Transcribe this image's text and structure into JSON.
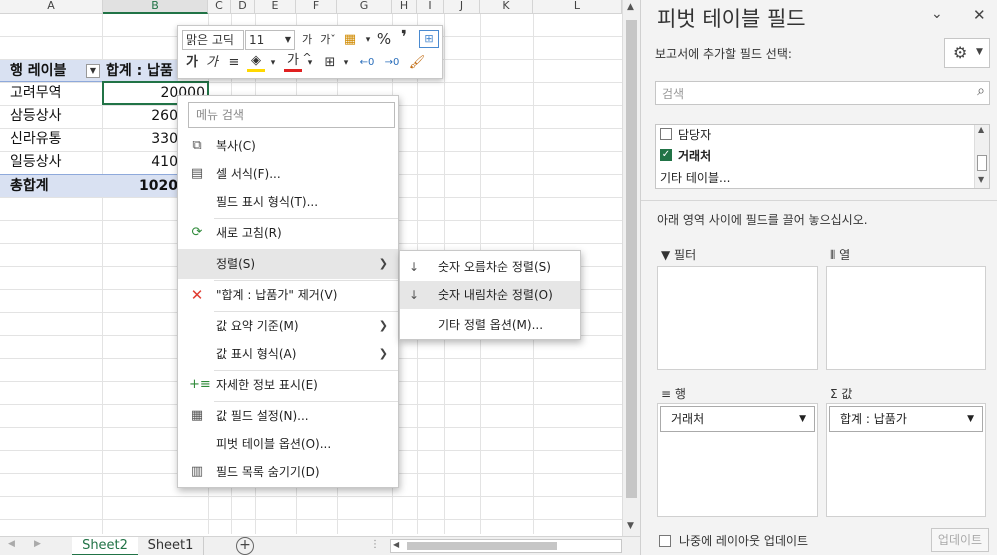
{
  "columns": [
    "A",
    "B",
    "C",
    "D",
    "E",
    "F",
    "G",
    "H",
    "I",
    "J",
    "K",
    "L"
  ],
  "pivot": {
    "row_label_header": "행 레이블",
    "value_header": "합계 : 납품",
    "rows": [
      {
        "label": "고려무역",
        "value": "20000"
      },
      {
        "label": "삼등상사",
        "value": "260"
      },
      {
        "label": "신라유통",
        "value": "330"
      },
      {
        "label": "일등상사",
        "value": "410"
      }
    ],
    "total_label": "총합계",
    "total_value": "1020"
  },
  "mini_toolbar": {
    "font_name": "맑은 고딕",
    "font_size": "11",
    "grow_font": "가^",
    "shrink_font": "가ˇ",
    "bold": "가",
    "italic": "가",
    "font_color_glyph": "가"
  },
  "context_menu": {
    "search_placeholder": "메뉴 검색",
    "items": [
      {
        "label": "복사(C)"
      },
      {
        "label": "셀 서식(F)..."
      },
      {
        "label": "필드 표시 형식(T)..."
      },
      {
        "label": "새로 고침(R)"
      },
      {
        "label": "정렬(S)"
      },
      {
        "label": "\"합계 : 납품가\" 제거(V)"
      },
      {
        "label": "값 요약 기준(M)"
      },
      {
        "label": "값 표시 형식(A)"
      },
      {
        "label": "자세한 정보 표시(E)"
      },
      {
        "label": "값 필드 설정(N)..."
      },
      {
        "label": "피벗 테이블 옵션(O)..."
      },
      {
        "label": "필드 목록 숨기기(D)"
      }
    ]
  },
  "sort_submenu": {
    "items": [
      {
        "label": "숫자 오름차순 정렬(S)"
      },
      {
        "label": "숫자 내림차순 정렬(O)"
      },
      {
        "label": "기타 정렬 옵션(M)..."
      }
    ]
  },
  "sheet_tabs": [
    "Sheet2",
    "Sheet1"
  ],
  "field_pane": {
    "title": "피벗 테이블 필드",
    "choose_label": "보고서에 추가할 필드 선택:",
    "search_placeholder": "검색",
    "fields": [
      {
        "label": "담당자",
        "checked": false
      },
      {
        "label": "거래처",
        "checked": true
      },
      {
        "label": "기타 테이블...",
        "checked": false
      }
    ],
    "drag_hint": "아래 영역 사이에 필드를 끌어 놓으십시오.",
    "filter_label": "필터",
    "columns_label": "열",
    "rows_label": "행",
    "values_label": "값",
    "rows_field": "거래처",
    "values_field": "합계 : 납품가",
    "defer_label": "나중에 레이아웃 업데이트",
    "update_button": "업데이트"
  },
  "colors": {
    "accent": "#217346",
    "pivot_header_bg": "#d9e1f2",
    "menu_highlight": "#e6e6e6",
    "remove_icon": "#e03c31"
  }
}
